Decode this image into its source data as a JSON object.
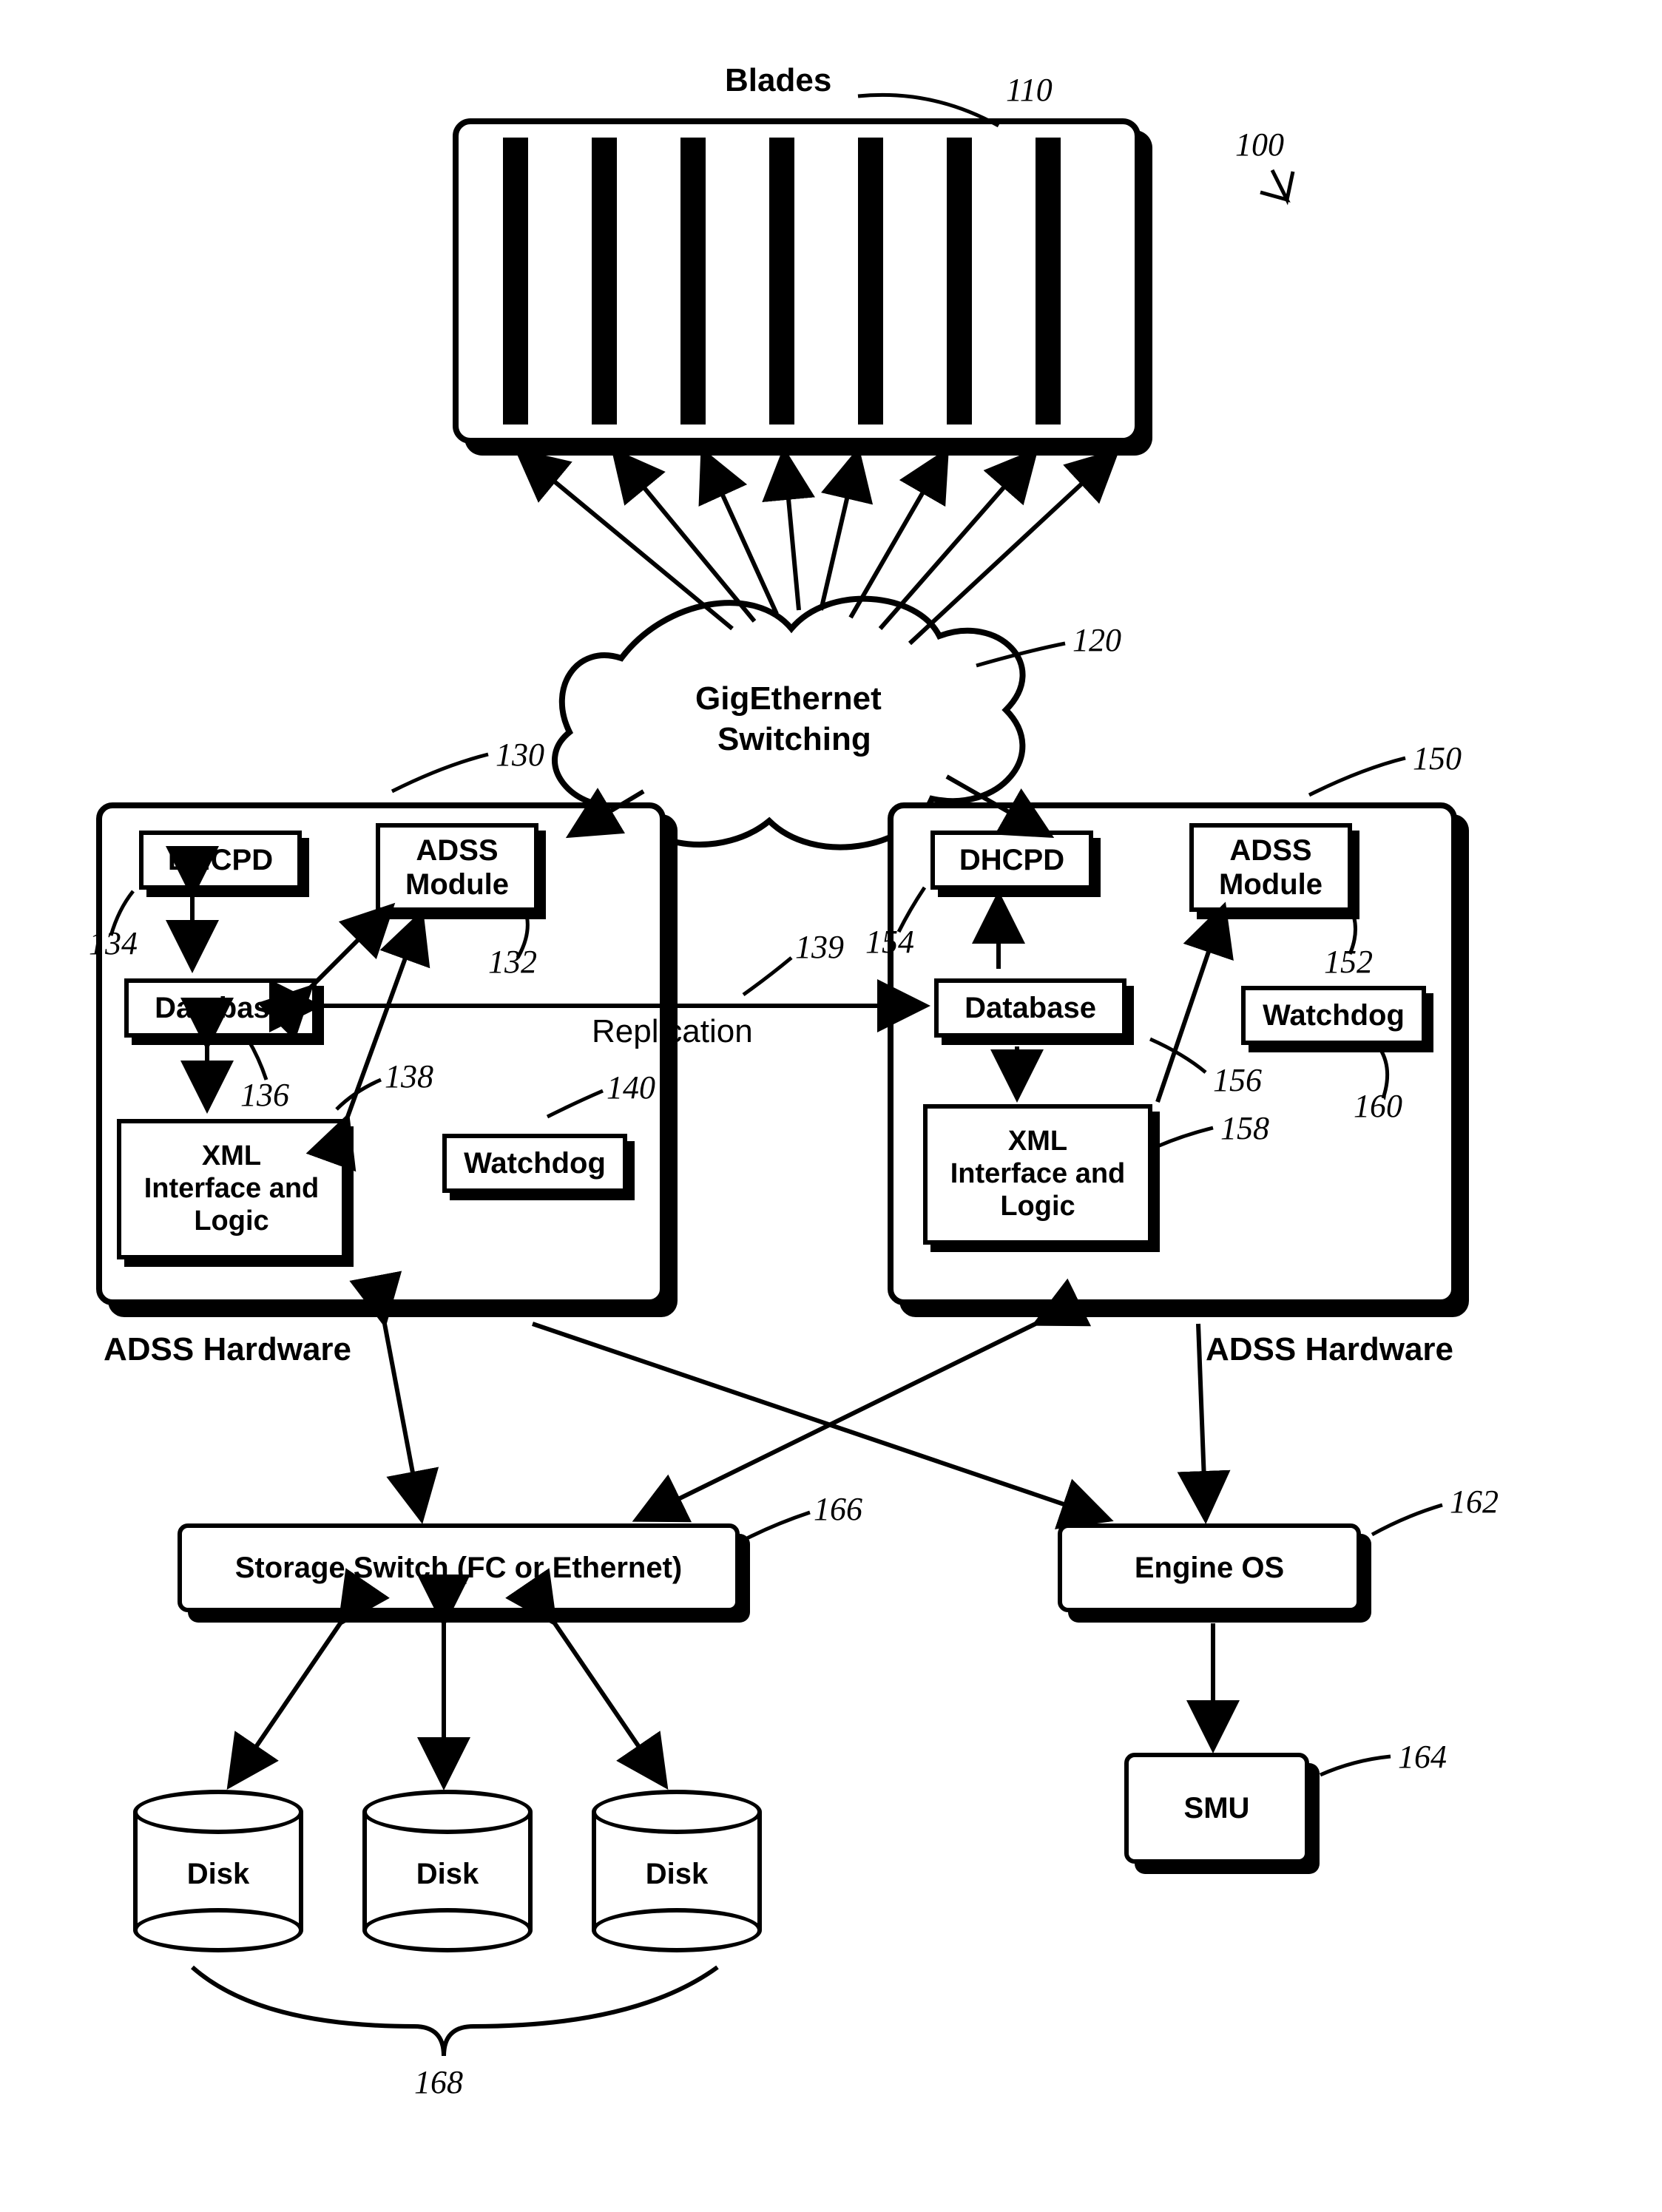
{
  "title": "Blades",
  "refs": {
    "r100": "100",
    "r110": "110",
    "r120": "120",
    "r130": "130",
    "r132": "132",
    "r134": "134",
    "r136": "136",
    "r138": "138",
    "r139": "139",
    "r140": "140",
    "r150": "150",
    "r152": "152",
    "r154": "154",
    "r156": "156",
    "r158": "158",
    "r160": "160",
    "r162": "162",
    "r164": "164",
    "r166": "166",
    "r168": "168"
  },
  "cloud": {
    "line1": "GigEthernet",
    "line2": "Switching"
  },
  "left": {
    "panelLabel": "ADSS Hardware",
    "dhcpd": "DHCPD",
    "adssModule": "ADSS\nModule",
    "database": "Database",
    "xml": "XML\nInterface and\nLogic",
    "watchdog": "Watchdog"
  },
  "right": {
    "panelLabel": "ADSS Hardware",
    "dhcpd": "DHCPD",
    "adssModule": "ADSS\nModule",
    "database": "Database",
    "xml": "XML\nInterface and\nLogic",
    "watchdog": "Watchdog"
  },
  "replication": "Replication",
  "storageSwitch": "Storage Switch (FC or Ethernet)",
  "engineOS": "Engine OS",
  "smu": "SMU",
  "disk": "Disk"
}
